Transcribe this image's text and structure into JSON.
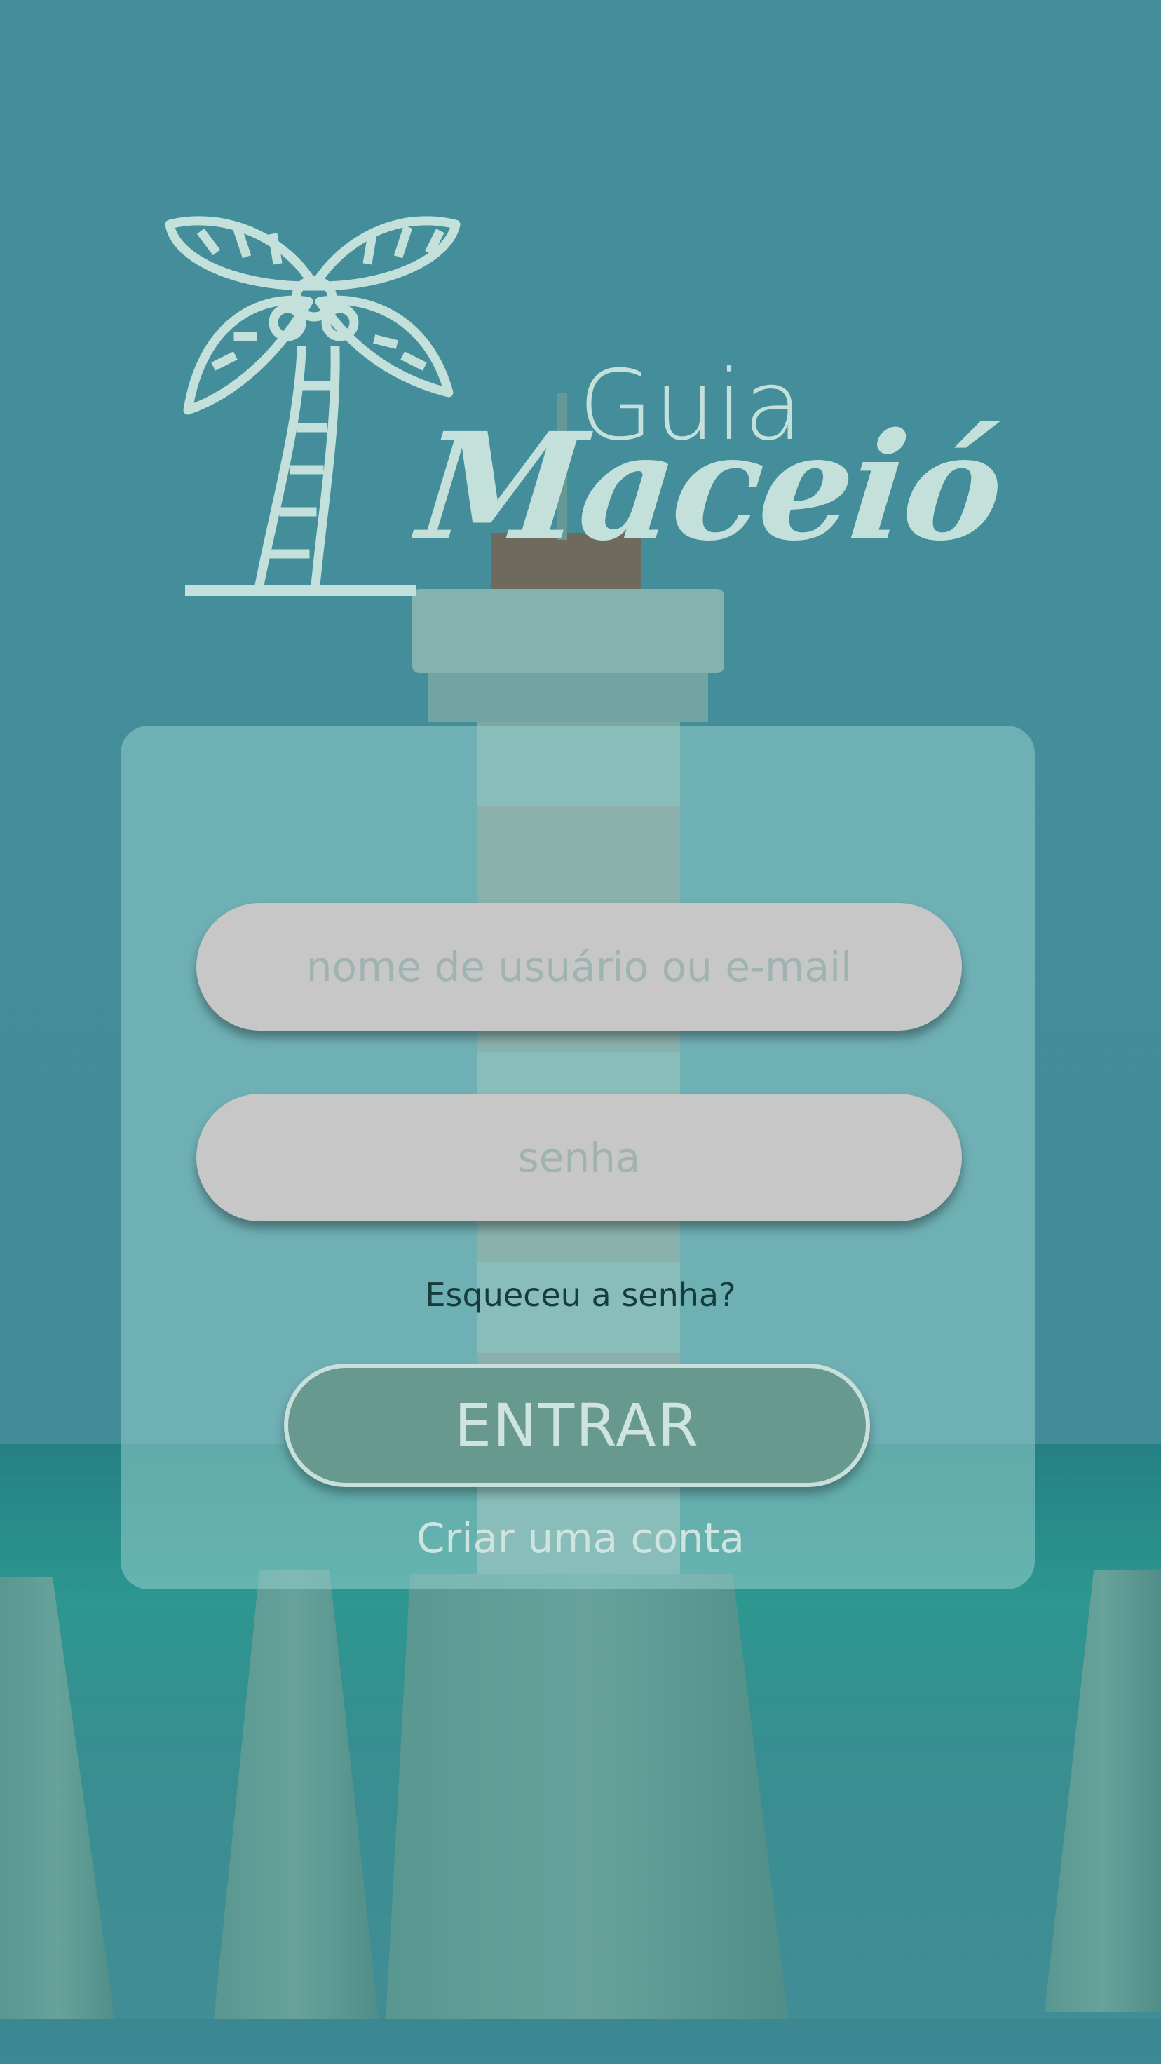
{
  "logo": {
    "line1": "Guia",
    "line2": "Maceió"
  },
  "login": {
    "username_placeholder": "nome de  usuário ou e-mail",
    "password_placeholder": "senha",
    "forgot_label": "Esqueceu a senha?",
    "enter_label": "ENTRAR",
    "create_label": "Criar uma conta"
  },
  "icons": {
    "logo_icon": "palm-tree-icon"
  },
  "colors": {
    "logo_text": "#c4e0da",
    "field_bg": "#c7c7c7",
    "enter_button_bg": "#67998f",
    "card_bg": "#94cdcc"
  }
}
